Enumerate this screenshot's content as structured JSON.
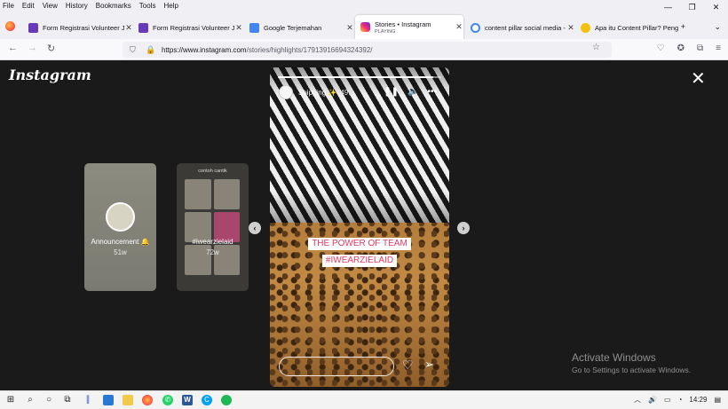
{
  "menu": [
    "File",
    "Edit",
    "View",
    "History",
    "Bookmarks",
    "Tools",
    "Help"
  ],
  "tabs": [
    {
      "title": "Form Registrasi Volunteer Ja",
      "icon": "forms-icon",
      "color": "#673ab7"
    },
    {
      "title": "Form Registrasi Volunteer Ja",
      "icon": "forms-icon",
      "color": "#673ab7"
    },
    {
      "title": "Google Terjemahan",
      "icon": "translate-icon",
      "color": "#4285f4"
    },
    {
      "title": "Stories • Instagram",
      "subtitle": "PLAYING",
      "icon": "instagram-icon",
      "color": "#e1306c",
      "active": true
    },
    {
      "title": "content pillar social media -",
      "icon": "google-icon",
      "color": "#4285f4"
    },
    {
      "title": "Apa itu Content Pillar? Peng",
      "icon": "emoji-icon",
      "color": "#f4c20d"
    }
  ],
  "url": {
    "base": "https://www.instagram.com",
    "path": "/stories/highlights/17913916694324392/"
  },
  "instagram": {
    "logo": "Instagram",
    "highlights": [
      {
        "label": "Announcement 🔔",
        "age": "51w"
      },
      {
        "label": "#iwearzielaid",
        "age": "72w",
        "top_text": "contoh cantik"
      }
    ],
    "story": {
      "username": "Shipping ✨",
      "time": "49w",
      "progress": 0.95,
      "sticker_lines": [
        "THE POWER OF TEAM",
        "#IWEARZIELAID"
      ]
    }
  },
  "watermark": {
    "title": "Activate Windows",
    "subtitle": "Go to Settings to activate Windows."
  },
  "taskbar": {
    "time": "14:29"
  },
  "colors": {
    "accent": "#e8375f",
    "ig_bg": "#1a1a1a"
  }
}
